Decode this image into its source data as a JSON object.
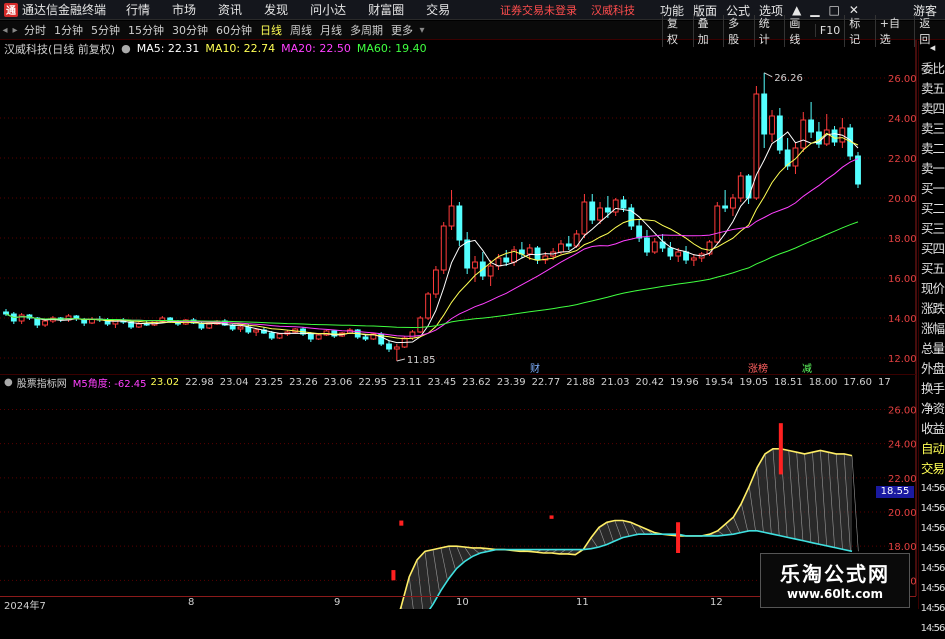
{
  "app": {
    "title": "通达信金融终端",
    "logo_text": "通"
  },
  "menu": [
    "行情",
    "市场",
    "资讯",
    "发现",
    "问小达",
    "财富圈",
    "交易"
  ],
  "notice": {
    "left": "证券交易未登录",
    "right": "汉威科技"
  },
  "top_right": [
    "功能",
    "版面",
    "公式",
    "选项"
  ],
  "guest": "游客",
  "periods": [
    "分时",
    "1分钟",
    "5分钟",
    "15分钟",
    "30分钟",
    "60分钟",
    "日线",
    "周线",
    "月线",
    "多周期",
    "更多"
  ],
  "active_period": "日线",
  "tools": [
    "复权",
    "叠加",
    "多股",
    "统计",
    "画线",
    "F10",
    "标记",
    "+自选",
    "返回"
  ],
  "stock_label": "汉威科技(日线 前复权)",
  "ma": [
    {
      "label": "MA5: 22.31",
      "color": "#ffffff"
    },
    {
      "label": "MA10: 22.74",
      "color": "#ffff54"
    },
    {
      "label": "MA20: 22.50",
      "color": "#ff40ff"
    },
    {
      "label": "MA60: 19.40",
      "color": "#40ff40"
    }
  ],
  "sidebar": [
    "委比",
    "卖五",
    "卖四",
    "卖三",
    "卖二",
    "卖一",
    "买一",
    "买二",
    "买三",
    "买四",
    "买五",
    "现价",
    "涨跌",
    "涨幅",
    "总量",
    "外盘",
    "换手",
    "净资",
    "收益",
    "自动",
    "交易",
    "14:56",
    "14:56",
    "14:56",
    "14:56",
    "14:56",
    "14:56",
    "14:56",
    "14:56"
  ],
  "indicator": {
    "name": "股票指标网",
    "label": "M5角度: -62.45",
    "values": [
      "23.02",
      "22.98",
      "23.04",
      "23.25",
      "23.26",
      "23.06",
      "22.95",
      "23.11",
      "23.45",
      "23.62",
      "23.39",
      "22.77",
      "21.88",
      "21.03",
      "20.42",
      "19.96",
      "19.54",
      "19.05",
      "18.51",
      "18.00",
      "17.60",
      "17"
    ],
    "badge": "18.55"
  },
  "markers": [
    {
      "text": "财",
      "color": "#7fb0ff"
    },
    {
      "text": "涨榜",
      "color": "#ff6060"
    },
    {
      "text": "减",
      "color": "#60ff60"
    }
  ],
  "annotations": {
    "high": "26.26",
    "low": "11.85"
  },
  "timeline": [
    "2024年7",
    "8",
    "9",
    "10",
    "11",
    "12"
  ],
  "watermark": {
    "line1": "乐淘公式网",
    "line2": "www.60lt.com"
  },
  "chart_data": [
    {
      "type": "candlestick",
      "title": "汉威科技(日线 前复权)",
      "y_ticks": [
        12,
        14,
        16,
        18,
        20,
        22,
        24,
        26
      ],
      "ylim": [
        11.3,
        27
      ],
      "grid": true,
      "candles_ohlc": [
        [
          14.3,
          14.45,
          14.1,
          14.2
        ],
        [
          14.2,
          14.3,
          13.7,
          13.85
        ],
        [
          13.85,
          14.25,
          13.7,
          14.15
        ],
        [
          14.15,
          14.2,
          13.9,
          14.0
        ],
        [
          14.0,
          14.05,
          13.5,
          13.65
        ],
        [
          13.65,
          13.95,
          13.55,
          13.85
        ],
        [
          13.85,
          14.1,
          13.75,
          14.0
        ],
        [
          14.0,
          14.05,
          13.8,
          13.9
        ],
        [
          13.9,
          14.2,
          13.8,
          14.1
        ],
        [
          14.1,
          14.15,
          13.85,
          13.95
        ],
        [
          13.95,
          14.0,
          13.6,
          13.75
        ],
        [
          13.75,
          14.05,
          13.7,
          13.95
        ],
        [
          13.95,
          14.1,
          13.8,
          13.9
        ],
        [
          13.9,
          14.0,
          13.6,
          13.7
        ],
        [
          13.7,
          13.95,
          13.5,
          13.9
        ],
        [
          13.9,
          14.0,
          13.7,
          13.8
        ],
        [
          13.8,
          13.85,
          13.45,
          13.55
        ],
        [
          13.55,
          13.8,
          13.5,
          13.7
        ],
        [
          13.7,
          13.85,
          13.6,
          13.65
        ],
        [
          13.65,
          13.9,
          13.6,
          13.85
        ],
        [
          13.85,
          14.1,
          13.8,
          14.0
        ],
        [
          14.0,
          14.05,
          13.75,
          13.8
        ],
        [
          13.8,
          13.9,
          13.6,
          13.7
        ],
        [
          13.7,
          13.95,
          13.65,
          13.9
        ],
        [
          13.9,
          14.0,
          13.7,
          13.75
        ],
        [
          13.75,
          13.8,
          13.4,
          13.5
        ],
        [
          13.5,
          13.75,
          13.45,
          13.7
        ],
        [
          13.7,
          13.9,
          13.65,
          13.85
        ],
        [
          13.85,
          13.95,
          13.6,
          13.65
        ],
        [
          13.65,
          13.7,
          13.35,
          13.45
        ],
        [
          13.45,
          13.6,
          13.3,
          13.55
        ],
        [
          13.55,
          13.7,
          13.2,
          13.3
        ],
        [
          13.3,
          13.5,
          13.1,
          13.4
        ],
        [
          13.4,
          13.55,
          13.2,
          13.25
        ],
        [
          13.25,
          13.35,
          12.9,
          13.0
        ],
        [
          13.0,
          13.25,
          12.95,
          13.2
        ],
        [
          13.2,
          13.4,
          13.1,
          13.3
        ],
        [
          13.3,
          13.5,
          13.25,
          13.45
        ],
        [
          13.45,
          13.55,
          13.1,
          13.2
        ],
        [
          13.2,
          13.3,
          12.8,
          12.95
        ],
        [
          12.95,
          13.2,
          12.9,
          13.15
        ],
        [
          13.15,
          13.4,
          13.1,
          13.35
        ],
        [
          13.35,
          13.4,
          13.0,
          13.1
        ],
        [
          13.1,
          13.3,
          13.05,
          13.25
        ],
        [
          13.25,
          13.5,
          13.2,
          13.4
        ],
        [
          13.4,
          13.45,
          12.95,
          13.05
        ],
        [
          13.05,
          13.2,
          12.85,
          12.95
        ],
        [
          12.95,
          13.25,
          12.9,
          13.2
        ],
        [
          13.2,
          13.3,
          12.6,
          12.7
        ],
        [
          12.7,
          12.85,
          12.3,
          12.45
        ],
        [
          12.45,
          12.7,
          11.85,
          12.55
        ],
        [
          12.55,
          13.1,
          12.5,
          13.0
        ],
        [
          13.0,
          13.4,
          12.9,
          13.3
        ],
        [
          13.3,
          14.1,
          13.25,
          14.0
        ],
        [
          14.0,
          15.3,
          13.9,
          15.2
        ],
        [
          15.2,
          16.6,
          15.0,
          16.4
        ],
        [
          16.4,
          18.8,
          16.2,
          18.6
        ],
        [
          18.6,
          20.4,
          18.4,
          19.6
        ],
        [
          19.6,
          19.8,
          17.6,
          17.9
        ],
        [
          17.9,
          18.3,
          16.2,
          16.5
        ],
        [
          16.5,
          17.1,
          15.8,
          16.8
        ],
        [
          16.8,
          17.3,
          15.9,
          16.1
        ],
        [
          16.1,
          16.9,
          15.6,
          16.6
        ],
        [
          16.6,
          17.2,
          16.4,
          17.0
        ],
        [
          17.0,
          17.4,
          16.6,
          16.8
        ],
        [
          16.8,
          17.6,
          16.6,
          17.4
        ],
        [
          17.4,
          17.8,
          17.0,
          17.2
        ],
        [
          17.2,
          17.7,
          16.9,
          17.5
        ],
        [
          17.5,
          17.6,
          16.7,
          16.9
        ],
        [
          16.9,
          17.3,
          16.7,
          17.1
        ],
        [
          17.1,
          17.5,
          16.9,
          17.3
        ],
        [
          17.3,
          17.9,
          17.2,
          17.7
        ],
        [
          17.7,
          18.1,
          17.4,
          17.6
        ],
        [
          17.6,
          18.4,
          17.5,
          18.2
        ],
        [
          18.2,
          20.2,
          18.0,
          19.8
        ],
        [
          19.8,
          20.2,
          18.7,
          18.9
        ],
        [
          18.9,
          19.8,
          18.7,
          19.5
        ],
        [
          19.5,
          20.1,
          19.0,
          19.3
        ],
        [
          19.3,
          20.0,
          19.1,
          19.9
        ],
        [
          19.9,
          20.1,
          19.3,
          19.5
        ],
        [
          19.5,
          19.7,
          18.4,
          18.6
        ],
        [
          18.6,
          18.9,
          17.8,
          18.0
        ],
        [
          18.0,
          18.4,
          17.1,
          17.3
        ],
        [
          17.3,
          18.0,
          17.2,
          17.8
        ],
        [
          17.8,
          18.2,
          17.3,
          17.5
        ],
        [
          17.5,
          17.8,
          16.9,
          17.1
        ],
        [
          17.1,
          17.5,
          16.8,
          17.3
        ],
        [
          17.3,
          17.6,
          16.7,
          16.9
        ],
        [
          16.9,
          17.2,
          16.6,
          17.0
        ],
        [
          17.0,
          17.3,
          16.8,
          17.2
        ],
        [
          17.2,
          17.9,
          17.1,
          17.8
        ],
        [
          17.8,
          19.8,
          17.7,
          19.6
        ],
        [
          19.6,
          20.4,
          19.3,
          19.5
        ],
        [
          19.5,
          20.2,
          19.1,
          20.0
        ],
        [
          20.0,
          21.3,
          19.8,
          21.1
        ],
        [
          21.1,
          21.2,
          19.7,
          20.0
        ],
        [
          20.0,
          25.6,
          19.9,
          25.2
        ],
        [
          25.2,
          26.26,
          22.5,
          23.2
        ],
        [
          23.2,
          24.4,
          22.8,
          24.1
        ],
        [
          24.1,
          24.5,
          22.2,
          22.4
        ],
        [
          22.4,
          23.0,
          21.4,
          21.6
        ],
        [
          21.6,
          22.8,
          21.2,
          22.5
        ],
        [
          22.5,
          24.3,
          22.3,
          23.9
        ],
        [
          23.9,
          24.8,
          23.0,
          23.3
        ],
        [
          23.3,
          23.8,
          22.5,
          22.7
        ],
        [
          22.7,
          24.2,
          22.6,
          23.4
        ],
        [
          23.4,
          23.6,
          22.6,
          22.8
        ],
        [
          22.8,
          24.0,
          22.5,
          23.5
        ],
        [
          23.5,
          23.7,
          21.9,
          22.1
        ],
        [
          22.1,
          22.3,
          20.5,
          20.7
        ]
      ],
      "series": [
        {
          "name": "MA5: 22.31",
          "color": "#ffffff"
        },
        {
          "name": "MA10: 22.74",
          "color": "#ffff54"
        },
        {
          "name": "MA20: 22.50",
          "color": "#ff40ff"
        },
        {
          "name": "MA60: 19.40",
          "color": "#40ff40"
        }
      ]
    },
    {
      "type": "line",
      "title": "股票指标网",
      "y_ticks": [
        16,
        18,
        20,
        22,
        24,
        26
      ],
      "ylim": [
        15.2,
        27.2
      ],
      "series": [
        {
          "color": "#ffee66",
          "values": [
            13.4,
            13.35,
            13.3,
            13.2,
            13.1,
            13.0,
            12.95,
            13.0,
            13.05,
            13.1,
            13.0,
            12.9,
            12.8,
            12.7,
            12.65,
            12.7,
            12.8,
            12.9,
            13.0,
            12.9,
            12.85,
            12.8,
            12.75,
            12.7,
            12.8,
            12.9,
            13.0,
            12.95,
            12.9,
            12.8,
            12.75,
            12.8,
            12.85,
            12.9,
            12.8,
            12.7,
            12.75,
            12.8,
            12.9,
            12.85,
            12.8,
            12.75,
            12.7,
            12.65,
            12.6,
            12.6,
            12.65,
            12.7,
            12.75,
            13.0,
            14.5,
            16.2,
            17.2,
            17.7,
            17.8,
            17.9,
            18.0,
            18.0,
            17.95,
            17.9,
            17.9,
            17.85,
            17.8,
            17.8,
            17.75,
            17.7,
            17.7,
            17.65,
            17.6,
            17.6,
            17.55,
            17.55,
            17.5,
            17.8,
            18.5,
            19.1,
            19.4,
            19.5,
            19.5,
            19.4,
            19.2,
            19.0,
            18.8,
            18.7,
            18.65,
            18.6,
            18.6,
            18.6,
            18.6,
            18.7,
            18.9,
            19.3,
            19.7,
            20.5,
            21.5,
            22.6,
            23.4,
            23.7,
            23.7,
            23.6,
            23.5,
            23.4,
            23.5,
            23.6,
            23.5,
            23.4,
            23.4,
            23.3
          ]
        },
        {
          "color": "#40e0e0",
          "values": [
            13.6,
            13.6,
            13.55,
            13.5,
            13.45,
            13.4,
            13.35,
            13.3,
            13.3,
            13.25,
            13.2,
            13.2,
            13.15,
            13.1,
            13.05,
            13.05,
            13.0,
            13.0,
            12.95,
            12.95,
            12.9,
            12.9,
            12.85,
            12.85,
            12.8,
            12.8,
            12.8,
            12.75,
            12.75,
            12.75,
            12.7,
            12.7,
            12.7,
            12.7,
            12.65,
            12.65,
            12.65,
            12.6,
            12.6,
            12.6,
            12.6,
            12.6,
            12.55,
            12.55,
            12.55,
            12.55,
            12.55,
            12.55,
            12.55,
            12.6,
            12.7,
            12.9,
            13.3,
            13.9,
            14.6,
            15.4,
            16.1,
            16.7,
            17.1,
            17.4,
            17.6,
            17.7,
            17.8,
            17.8,
            17.8,
            17.8,
            17.8,
            17.8,
            17.8,
            17.8,
            17.8,
            17.8,
            17.8,
            17.8,
            17.85,
            17.95,
            18.1,
            18.3,
            18.5,
            18.6,
            18.7,
            18.7,
            18.7,
            18.7,
            18.7,
            18.7,
            18.6,
            18.6,
            18.6,
            18.6,
            18.6,
            18.65,
            18.7,
            18.8,
            18.9,
            18.9,
            18.8,
            18.7,
            18.6,
            18.5,
            18.4,
            18.3,
            18.2,
            18.1,
            18.0,
            17.9,
            17.8,
            17.7
          ]
        }
      ],
      "bars": [
        {
          "index": 49,
          "from": 16.0,
          "to": 16.6
        },
        {
          "index": 50,
          "from": 19.2,
          "to": 19.5
        },
        {
          "index": 69,
          "from": 19.6,
          "to": 19.8
        },
        {
          "index": 85,
          "from": 17.6,
          "to": 19.4
        },
        {
          "index": 98,
          "from": 22.2,
          "to": 25.2
        }
      ]
    }
  ]
}
